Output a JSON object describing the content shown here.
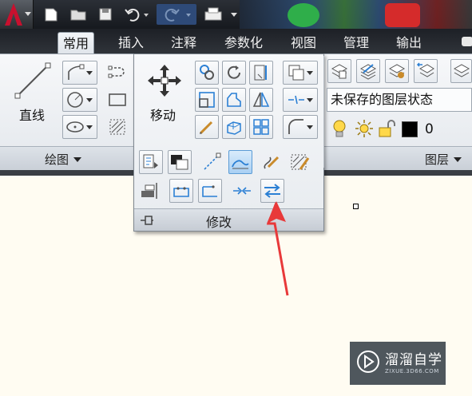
{
  "tabs": [
    {
      "label": "常用",
      "active": true
    },
    {
      "label": "插入"
    },
    {
      "label": "注释"
    },
    {
      "label": "参数化"
    },
    {
      "label": "视图"
    },
    {
      "label": "管理"
    },
    {
      "label": "输出"
    }
  ],
  "draw_panel": {
    "line_label": "直线",
    "title": "绘图"
  },
  "modify_panel": {
    "move_label": "移动",
    "title": "修改"
  },
  "layers_panel": {
    "layer_state": "未保存的图层状态",
    "current_layer": "0",
    "title": "图层"
  },
  "watermark": {
    "main": "溜溜自学",
    "sub": "ZIXUE.3D66.COM"
  },
  "colors": {
    "canvas": "#fffcf2",
    "accent_blue": "#2a7fd4",
    "arrow_red": "#e8393a",
    "autocad_red": "#c8102e"
  }
}
